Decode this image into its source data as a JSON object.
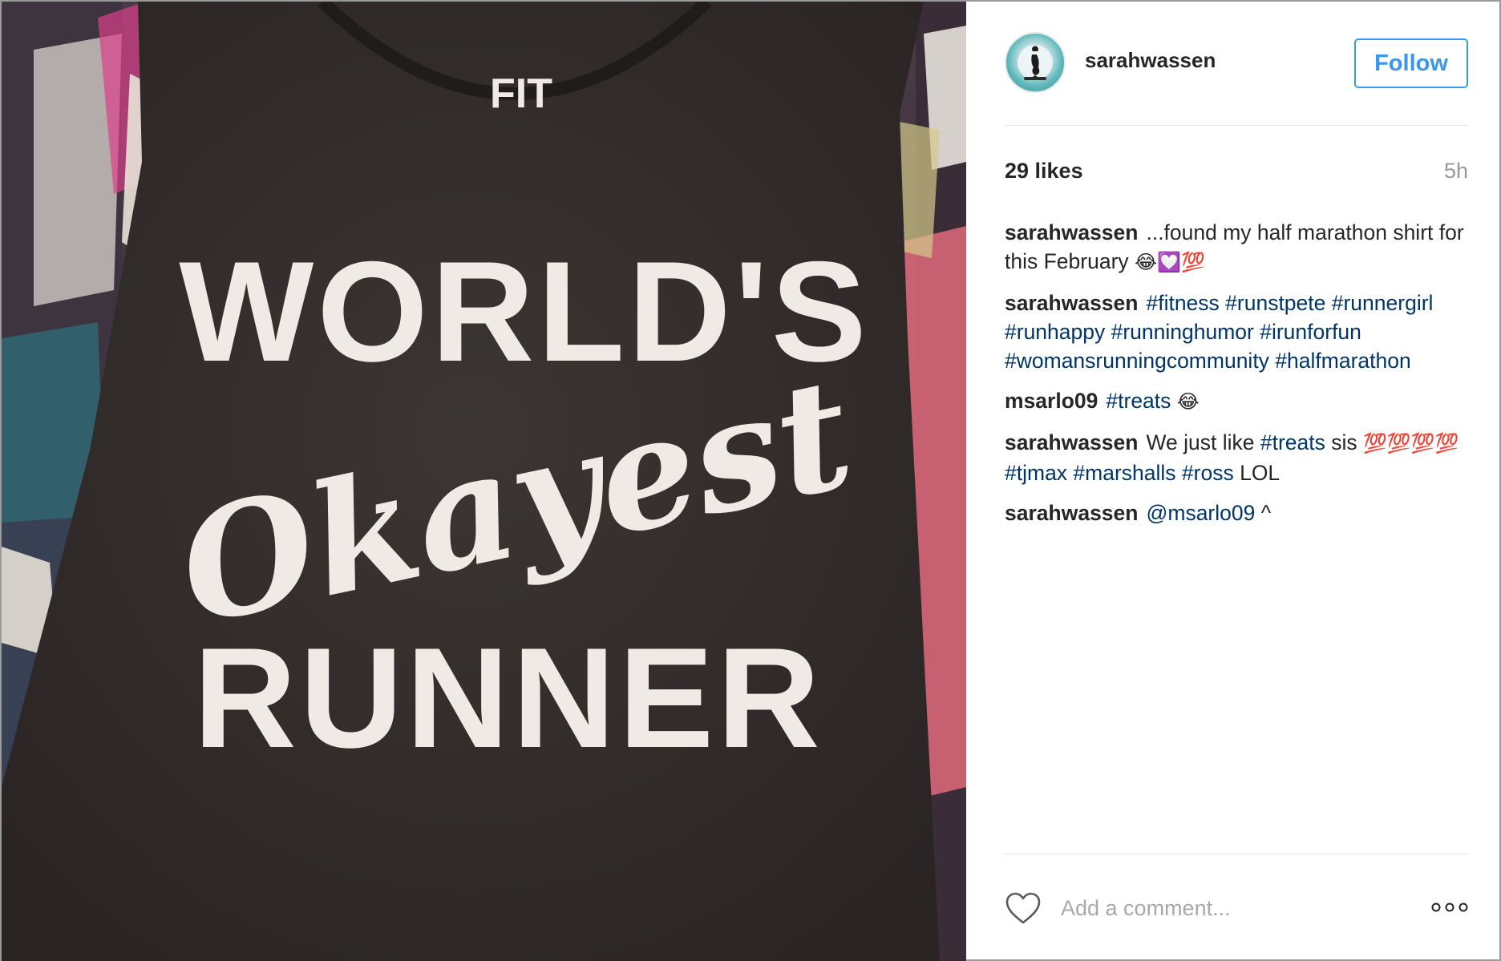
{
  "photo": {
    "shirt_top_text": "FIT",
    "shirt_line1": "WORLD'S",
    "shirt_line2": "Okayest",
    "shirt_line3": "RUNNER",
    "icon": "photo-image"
  },
  "header": {
    "username": "sarahwassen",
    "follow_label": "Follow",
    "avatar_icon": "mermaid-avatar-icon"
  },
  "stats": {
    "likes": "29 likes",
    "time": "5h"
  },
  "comments": [
    {
      "author": "sarahwassen",
      "text": "...found my half marathon shirt for this February",
      "emojis": "😂💟💯"
    },
    {
      "author": "sarahwassen",
      "tags": "#fitness #runstpete #runnergirl #runhappy #runninghumor #irunforfun #womansrunningcommunity #halfmarathon"
    },
    {
      "author": "msarlo09",
      "tag": "#treats",
      "emoji": "😂"
    },
    {
      "author": "sarahwassen",
      "text_before": "We just like",
      "tag1": "#treats",
      "text_mid": "sis",
      "emojis": "💯💯💯💯",
      "tags2": "#tjmax #marshalls #ross",
      "text_after": "LOL"
    },
    {
      "author": "sarahwassen",
      "mention": "@msarlo09",
      "text": "^"
    }
  ],
  "footer": {
    "comment_placeholder": "Add a comment...",
    "heart_icon": "heart-icon",
    "more_icon": "more-options-icon"
  },
  "colors": {
    "accent": "#3897f0",
    "hashtag": "#003569",
    "muted": "#999999"
  }
}
